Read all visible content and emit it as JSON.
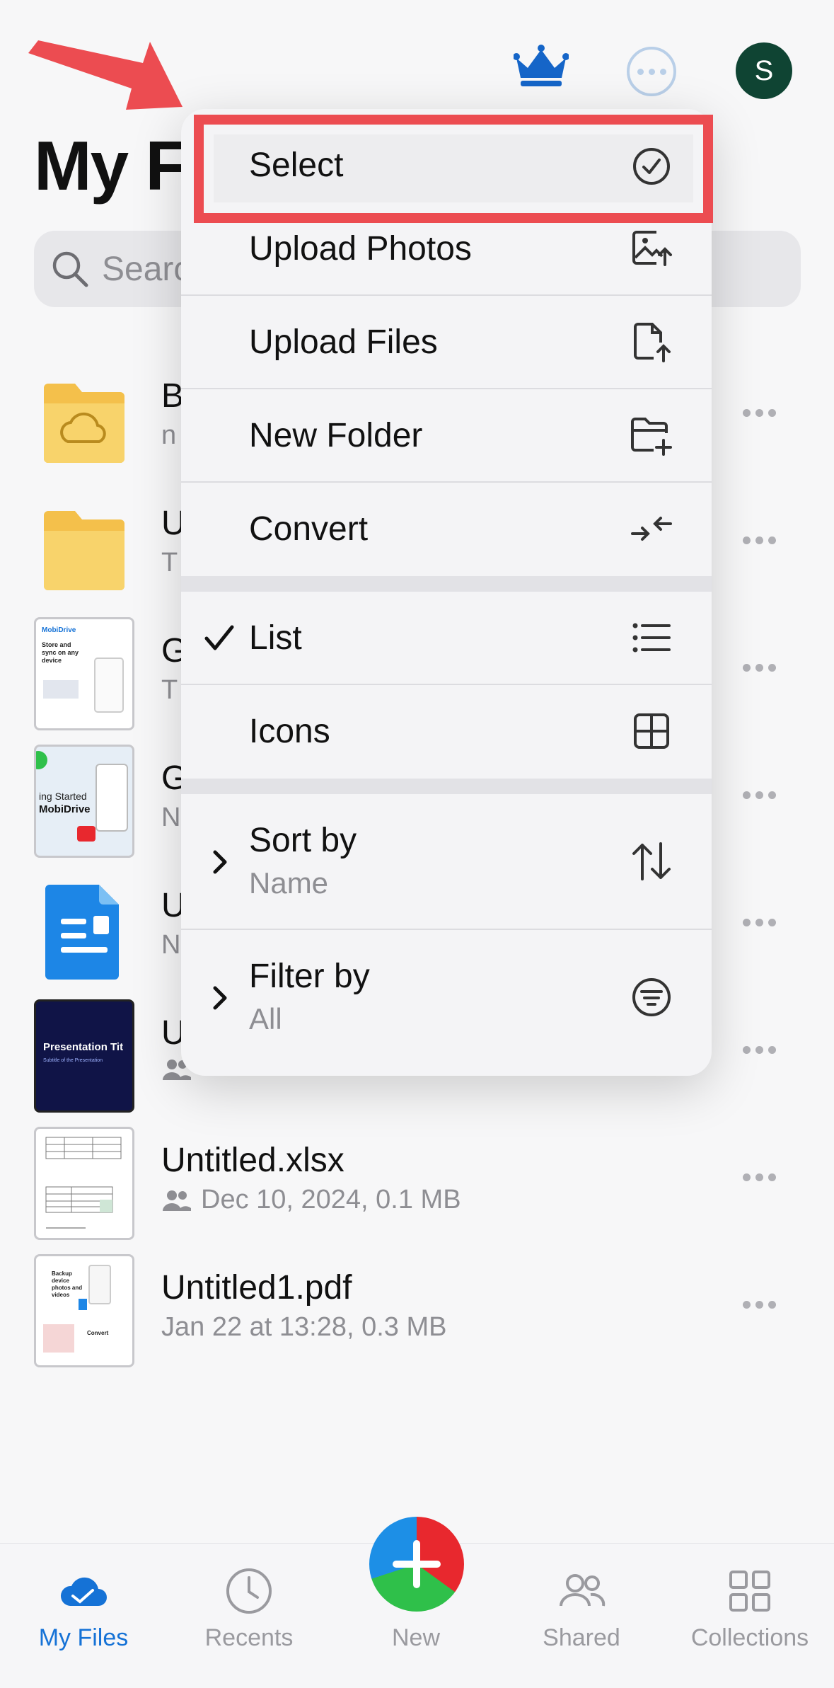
{
  "header": {
    "avatar_initial": "S",
    "page_title": "My Files"
  },
  "search": {
    "placeholder": "Search"
  },
  "files": [
    {
      "name": "B",
      "meta": "n"
    },
    {
      "name": "U",
      "meta": "T"
    },
    {
      "name": "G",
      "meta": "T"
    },
    {
      "name": "G",
      "meta": "N"
    },
    {
      "name": "U",
      "meta": "N"
    },
    {
      "name": "U",
      "meta": ""
    },
    {
      "name": "Untitled.xlsx",
      "meta": "Dec 10, 2024, 0.1 MB"
    },
    {
      "name": "Untitled1.pdf",
      "meta": "Jan 22 at 13:28, 0.3 MB"
    }
  ],
  "thumbs": {
    "mobidrive_brand": "MobiDrive",
    "mobidrive_caption": "Store and sync on any device",
    "started_line1": "ing Started",
    "started_line2": "MobiDrive",
    "pres_title": "Presentation Tit",
    "pres_subtitle": "Subtitle of the Presentation",
    "pdf_caption1": "Backup device photos and videos",
    "pdf_caption2": "Convert"
  },
  "menu": {
    "select": "Select",
    "upload_photos": "Upload Photos",
    "upload_files": "Upload Files",
    "new_folder": "New Folder",
    "convert": "Convert",
    "list": "List",
    "icons": "Icons",
    "sort_by": "Sort by",
    "sort_value": "Name",
    "filter_by": "Filter by",
    "filter_value": "All"
  },
  "tabs": {
    "my_files": "My Files",
    "recents": "Recents",
    "new": "New",
    "shared": "Shared",
    "collections": "Collections"
  },
  "colors": {
    "accent": "#1572d6",
    "highlight": "#ec4c51",
    "avatar": "#0f4433"
  }
}
